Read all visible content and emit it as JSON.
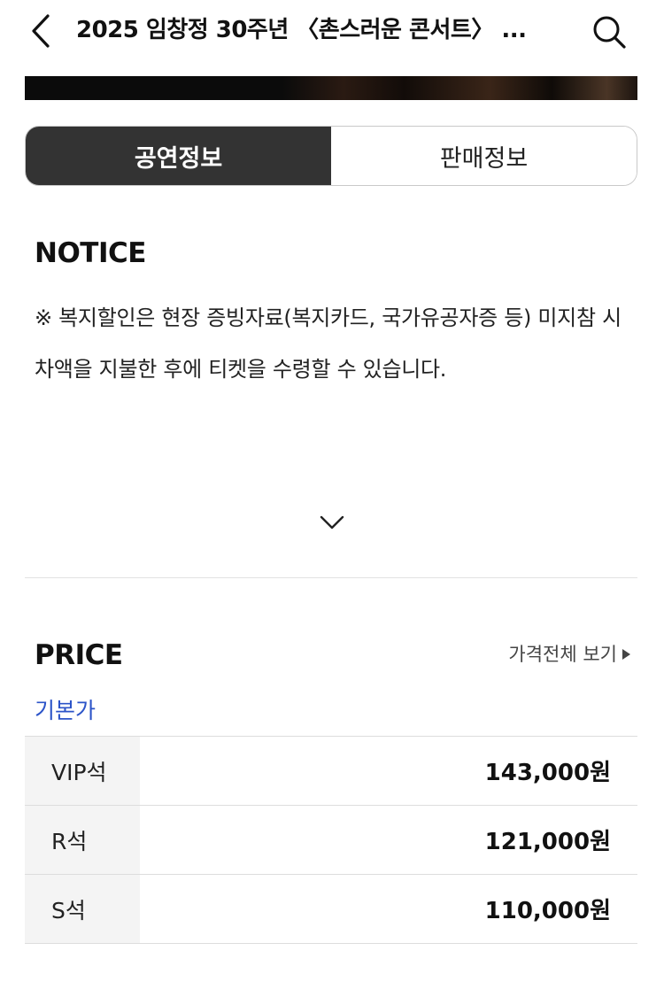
{
  "header": {
    "title": "2025 임창정 30주년 〈촌스러운 콘서트〉 ...",
    "back_icon": "chevron-left-icon",
    "search_icon": "search-icon"
  },
  "tabs": [
    {
      "label": "공연정보",
      "active": true
    },
    {
      "label": "판매정보",
      "active": false
    }
  ],
  "notice": {
    "title": "NOTICE",
    "text": "※ 복지할인은 현장 증빙자료(복지카드, 국가유공자증 등) 미지참 시 차액을 지불한 후에 티켓을 수령할 수 있습니다.",
    "expand_icon": "chevron-down-icon"
  },
  "price": {
    "title": "PRICE",
    "view_all_label": "가격전체 보기",
    "category_label": "기본가",
    "rows": [
      {
        "grade": "VIP석",
        "amount": "143,000원"
      },
      {
        "grade": "R석",
        "amount": "121,000원"
      },
      {
        "grade": "S석",
        "amount": "110,000원"
      }
    ]
  },
  "colors": {
    "active_tab_bg": "#333333",
    "accent_blue": "#2c54c8"
  }
}
